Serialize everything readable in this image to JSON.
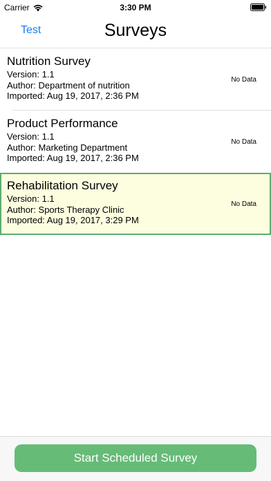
{
  "status_bar": {
    "carrier": "Carrier",
    "time": "3:30 PM"
  },
  "nav": {
    "left_button": "Test",
    "title": "Surveys"
  },
  "surveys": [
    {
      "title": "Nutrition Survey",
      "version": "Version: 1.1",
      "author": "Author: Department of nutrition",
      "imported": "Imported: Aug 19, 2017, 2:36 PM",
      "status": "No Data",
      "selected": false
    },
    {
      "title": "Product Performance",
      "version": "Version: 1.1",
      "author": "Author: Marketing Department",
      "imported": "Imported: Aug 19, 2017, 2:36 PM",
      "status": "No Data",
      "selected": false
    },
    {
      "title": "Rehabilitation Survey",
      "version": "Version: 1.1",
      "author": "Author: Sports Therapy Clinic",
      "imported": "Imported: Aug 19, 2017, 3:29 PM",
      "status": "No Data",
      "selected": true
    }
  ],
  "toolbar": {
    "start_button": "Start Scheduled Survey"
  },
  "colors": {
    "accent": "#1a7cf5",
    "selected_bg": "#fdfde0",
    "selected_border": "#5cad6d",
    "button_bg": "#66bb77"
  },
  "icons": [
    "wifi-icon",
    "battery-icon"
  ]
}
